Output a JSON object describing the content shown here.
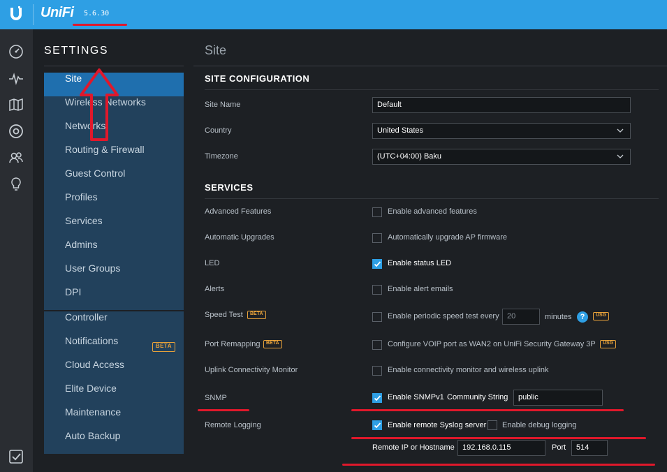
{
  "header": {
    "brand": "UniFi",
    "version": "5.6.30"
  },
  "leftnav": {
    "icons": [
      "dashboard-icon",
      "statistics-icon",
      "map-icon",
      "devices-icon",
      "clients-icon",
      "insights-icon",
      "tasks-icon"
    ]
  },
  "settings": {
    "title": "SETTINGS",
    "menu_primary": [
      {
        "label": "Site",
        "active": true
      },
      {
        "label": "Wireless Networks"
      },
      {
        "label": "Networks"
      },
      {
        "label": "Routing & Firewall"
      },
      {
        "label": "Guest Control"
      },
      {
        "label": "Profiles"
      },
      {
        "label": "Services"
      },
      {
        "label": "Admins"
      },
      {
        "label": "User Groups"
      },
      {
        "label": "DPI"
      }
    ],
    "menu_secondary": [
      {
        "label": "Controller"
      },
      {
        "label": "Notifications",
        "badge": "BETA"
      },
      {
        "label": "Cloud Access"
      },
      {
        "label": "Elite Device"
      },
      {
        "label": "Maintenance"
      },
      {
        "label": "Auto Backup"
      }
    ]
  },
  "main": {
    "page_title": "Site",
    "site_config": {
      "heading": "SITE CONFIGURATION",
      "site_name_label": "Site Name",
      "site_name_value": "Default",
      "country_label": "Country",
      "country_value": "United States",
      "timezone_label": "Timezone",
      "timezone_value": "(UTC+04:00) Baku"
    },
    "services": {
      "heading": "SERVICES",
      "advanced_label": "Advanced Features",
      "advanced_cb": "Enable advanced features",
      "upgrades_label": "Automatic Upgrades",
      "upgrades_cb": "Automatically upgrade AP firmware",
      "led_label": "LED",
      "led_cb": "Enable status LED",
      "alerts_label": "Alerts",
      "alerts_cb": "Enable alert emails",
      "speedtest_label": "Speed Test",
      "speedtest_badge": "BETA",
      "speedtest_cb": "Enable periodic speed test every",
      "speedtest_value": "20",
      "speedtest_unit": "minutes",
      "speedtest_help": "?",
      "speedtest_usg": "USG",
      "portremap_label": "Port Remapping",
      "portremap_badge": "BETA",
      "portremap_cb": "Configure VOIP port as WAN2 on UniFi Security Gateway 3P",
      "portremap_usg": "USG",
      "uplink_label": "Uplink Connectivity Monitor",
      "uplink_cb": "Enable connectivity monitor and wireless uplink",
      "snmp_label": "SNMP",
      "snmp_cb": "Enable SNMPv1",
      "snmp_community_label": "Community String",
      "snmp_community_value": "public",
      "remote_label": "Remote Logging",
      "remote_cb": "Enable remote Syslog server",
      "debug_cb": "Enable debug logging",
      "remote_ip_label": "Remote IP or Hostname",
      "remote_ip_value": "192.168.0.115",
      "port_label": "Port",
      "port_value": "514"
    }
  },
  "colors": {
    "accent": "#2e9fe4",
    "menu_bg": "#22415c",
    "menu_active": "#1f6fae",
    "annotation": "#e0182b"
  }
}
